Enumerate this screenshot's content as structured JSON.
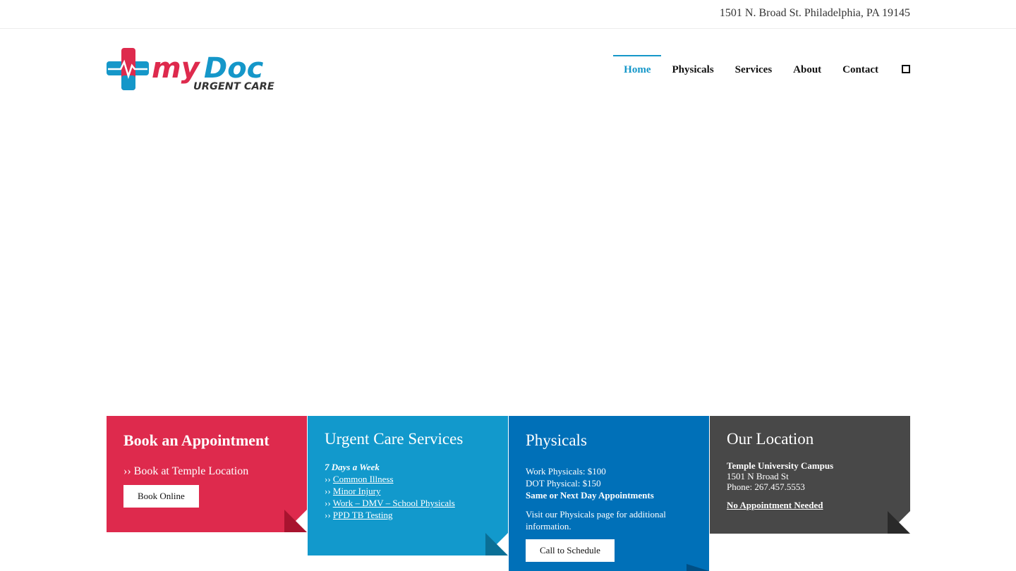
{
  "topbar": {
    "address": "1501 N. Broad St. Philadelphia, PA 19145"
  },
  "logo": {
    "brand_my": "myDoc",
    "brand_sub": "URGENT CARE",
    "colors": {
      "red": "#de2a4d",
      "blue": "#1597c9",
      "dark": "#333333"
    }
  },
  "nav": {
    "items": [
      {
        "label": "Home",
        "active": true
      },
      {
        "label": "Physicals"
      },
      {
        "label": "Services"
      },
      {
        "label": "About"
      },
      {
        "label": "Contact"
      }
    ],
    "search_icon": "square-search-icon"
  },
  "boxes": {
    "appointment": {
      "title": "Book an Appointment",
      "link": "›› Book at Temple Location",
      "button": "Book Online",
      "color": "#de2a4d"
    },
    "services": {
      "title": "Urgent Care Services",
      "subtitle": "7 Days a Week",
      "prefix": "›› ",
      "items": [
        "Common Illness",
        "Minor Injury",
        "Work – DMV – School Physicals",
        "PPD TB Testing"
      ],
      "color": "#1299cc"
    },
    "physicals": {
      "title": "Physicals",
      "line1": "Work Physicals: $100",
      "line2": "DOT Physical: $150",
      "line3": "Same or Next Day Appointments",
      "note": "Visit our Physicals page for additional information.",
      "button": "Call to Schedule",
      "color": "#0070b8"
    },
    "location": {
      "title": "Our Location",
      "campus": "Temple University Campus",
      "street": "1501 N Broad St",
      "phone": "Phone: 267.457.5553",
      "link": "No Appointment Needed",
      "color": "#484848"
    }
  }
}
